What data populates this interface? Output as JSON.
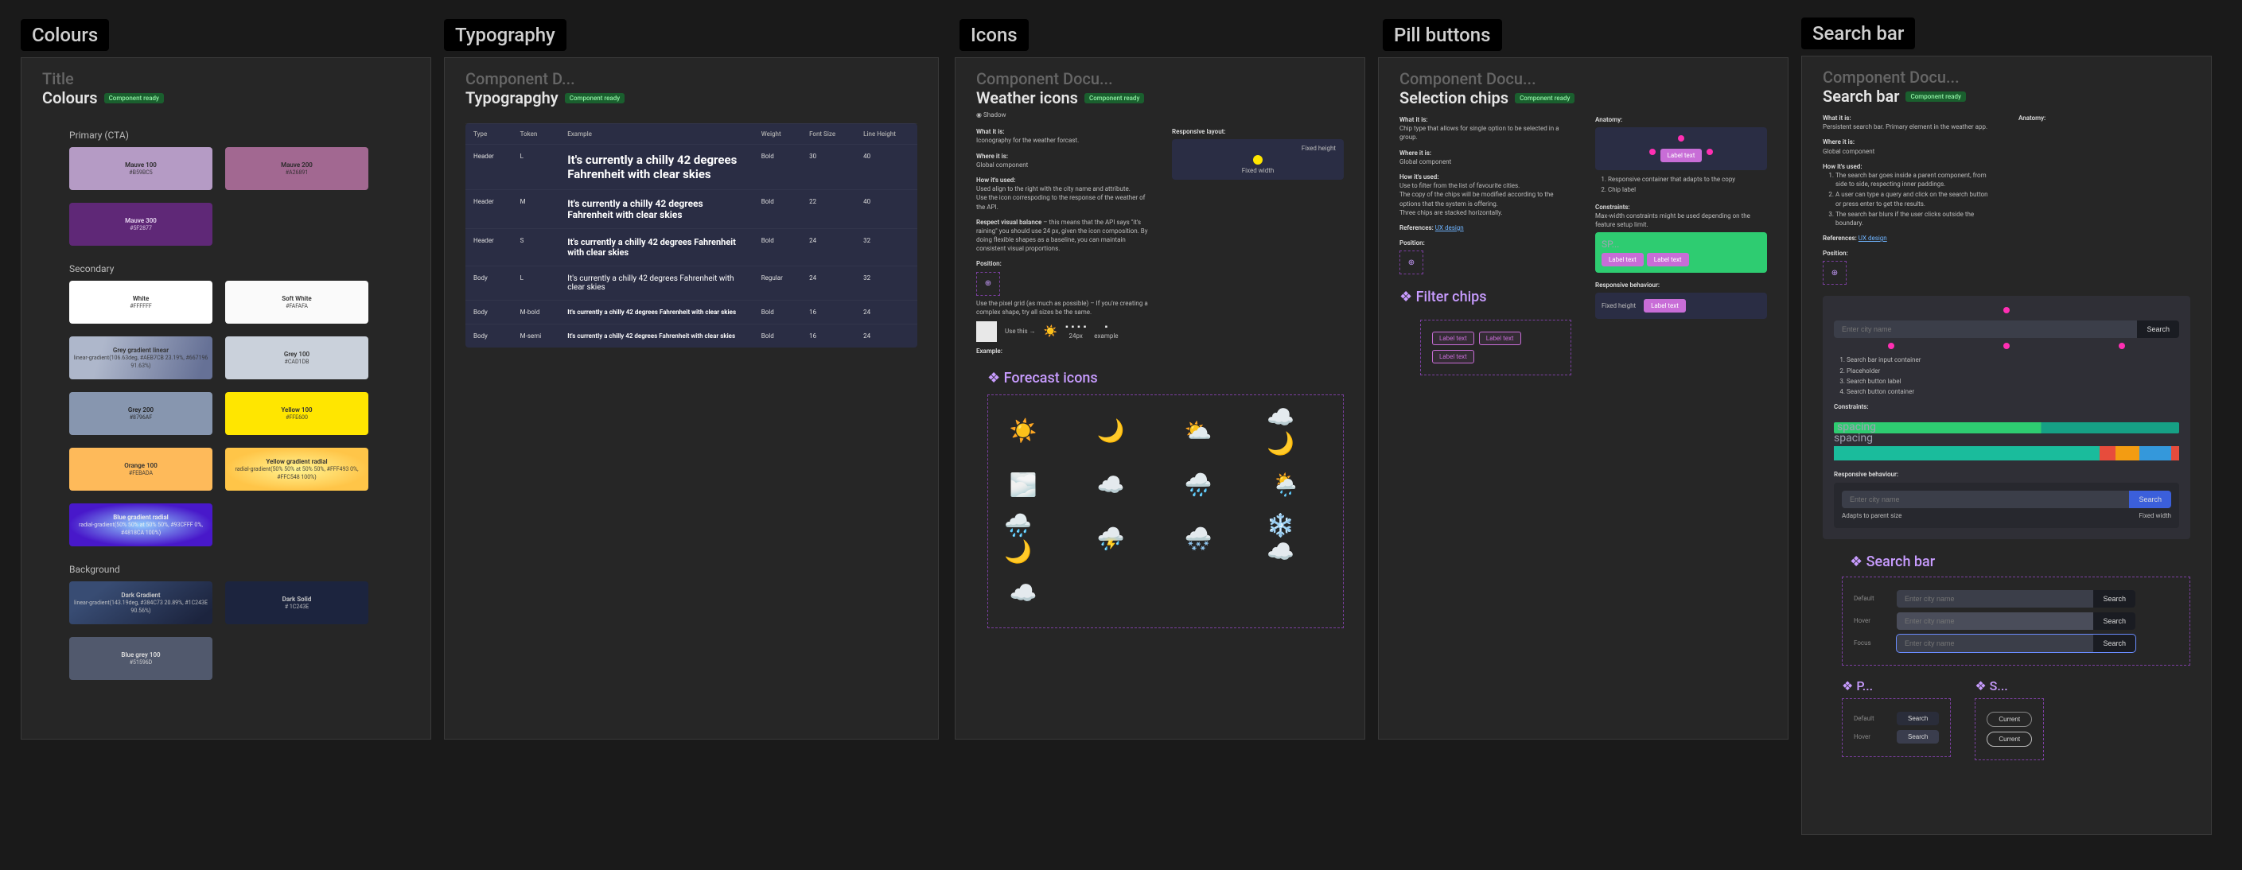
{
  "labels": {
    "colours": "Colours",
    "typography": "Typography",
    "icons": "Icons",
    "pill_buttons": "Pill buttons",
    "search_bar": "Search bar"
  },
  "common": {
    "component_docu": "Component Docu...",
    "component_d": "Component D...",
    "title": "Title",
    "component_ready": "Component ready",
    "what_it_is": "What it is:",
    "where_it_is": "Where it is:",
    "how_its_used": "How it's used:",
    "position": "Position:",
    "references": "References:",
    "anatomy": "Anatomy:",
    "constraints": "Constraints:",
    "responsive_behaviour": "Responsive behaviour:",
    "example": "Example:",
    "global_component": "Global component"
  },
  "colours": {
    "title": "Colours",
    "primary_h": "Primary (CTA)",
    "secondary_h": "Secondary",
    "background_h": "Background",
    "swatches": {
      "mauve100": {
        "name": "Mauve 100",
        "val": "#B59BC5",
        "bg": "#B59BC5",
        "fg": "#2a2a2a"
      },
      "mauve200": {
        "name": "Mauve 200",
        "val": "#A26891",
        "bg": "#A26891",
        "fg": "#2a2a2a"
      },
      "mauve300": {
        "name": "Mauve 300",
        "val": "#5F2877",
        "bg": "#5F2877",
        "fg": "#e8d7f2"
      },
      "white": {
        "name": "White",
        "val": "#FFFFFF",
        "bg": "#FFFFFF",
        "fg": "#333"
      },
      "softwhite": {
        "name": "Soft White",
        "val": "#FAFAFA",
        "bg": "#FAFAFA",
        "fg": "#333"
      },
      "greygrad": {
        "name": "Grey gradient linear",
        "val": "linear-gradient(106.63deg, #AEB7CB 23.19%, #667196 91.63%)",
        "fg": "#333"
      },
      "grey100": {
        "name": "Grey 100",
        "val": "#CAD1DB",
        "bg": "#CAD1DB",
        "fg": "#333"
      },
      "grey200": {
        "name": "Grey 200",
        "val": "#8796AF",
        "bg": "#8796AF",
        "fg": "#222"
      },
      "yellow100": {
        "name": "Yellow 100",
        "val": "#FFE600",
        "bg": "#FFE600",
        "fg": "#333"
      },
      "orange100": {
        "name": "Orange 100",
        "val": "#FEBADA",
        "bg": "#FEBA5A",
        "fg": "#333"
      },
      "yellowrad": {
        "name": "Yellow gradient radial",
        "val": "radial-gradient(50% 50% at 50% 50%, #FFF493 0%, #FFC548 100%)",
        "fg": "#333"
      },
      "bluerad": {
        "name": "Blue gradient radial",
        "val": "radial-gradient(50% 50% at 50% 50%, #93CFFF 0%, #4818CA 100%)",
        "fg": "#eee"
      },
      "darkgrad": {
        "name": "Dark Gradient",
        "val": "linear-gradient(143.19deg, #384C73 20.89%, #1C243E 90.56%)",
        "fg": "#ccc"
      },
      "darksolid": {
        "name": "Dark Solid",
        "val": "# 1C243E",
        "bg": "#1C243E",
        "fg": "#ccc"
      },
      "bluegrey": {
        "name": "Blue grey 100",
        "val": "#51596D",
        "bg": "#51596D",
        "fg": "#ddd"
      }
    }
  },
  "typography": {
    "title": "Typograpghy",
    "headers": {
      "type": "Type",
      "token": "Token",
      "example": "Example",
      "weight": "Weight",
      "fontsize": "Font Size",
      "lineheight": "Line Height"
    },
    "rows": [
      {
        "type": "Header",
        "token": "L",
        "ex": "It's currently a chilly 42 degrees Fahrenheit with clear skies",
        "ex_fs": "15px",
        "ex_fw": "700",
        "weight": "Bold",
        "fs": "30",
        "lh": "40"
      },
      {
        "type": "Header",
        "token": "M",
        "ex": "It's currently a chilly 42 degrees Fahrenheit with clear skies",
        "ex_fs": "12px",
        "ex_fw": "700",
        "weight": "Bold",
        "fs": "22",
        "lh": "40"
      },
      {
        "type": "Header",
        "token": "S",
        "ex": "It's currently a chilly 42 degrees Fahrenheit with clear skies",
        "ex_fs": "11px",
        "ex_fw": "700",
        "weight": "Bold",
        "fs": "24",
        "lh": "32"
      },
      {
        "type": "Body",
        "token": "L",
        "ex": "It's currently a chilly 42 degrees Fahrenheit with clear skies",
        "ex_fs": "10px",
        "ex_fw": "400",
        "weight": "Regular",
        "fs": "24",
        "lh": "32"
      },
      {
        "type": "Body",
        "token": "M-bold",
        "ex": "It's currently a chilly 42 degrees Fahrenheit with clear skies",
        "ex_fs": "8px",
        "ex_fw": "700",
        "weight": "Bold",
        "fs": "16",
        "lh": "24"
      },
      {
        "type": "Body",
        "token": "M-semi",
        "ex": "It's currently a chilly 42 degrees Fahrenheit with clear skies",
        "ex_fs": "8px",
        "ex_fw": "600",
        "weight": "Bold",
        "fs": "16",
        "lh": "24"
      }
    ]
  },
  "icons": {
    "title": "Weather icons",
    "shadow": "Shadow",
    "what_it_is_copy": "Iconography for the weather forcast.",
    "how_used_1": "Used align to the right with the city name and attribute.",
    "how_used_2": "Use the icon correspoding to the response of the weather of the API.",
    "respect_head": "Respect visual balance",
    "respect_copy": "– this means that the API says \"it's raining\" you should use 24 px, given the icon composition. By doing flexible shapes as a baseline, you can maintain consistent visual proportions.",
    "pixel_grid": "Use the pixel grid (as much as possible) – If you're creating a complex shape, try all sizes be the same.",
    "responsive_layout": "Responsive layout:",
    "fixed_height": "Fixed height",
    "fixed_width": "Fixed width",
    "use_this": "Use this →",
    "px24": "24px",
    "example": "example",
    "forecast_heading": "❖ Forecast icons"
  },
  "pill": {
    "title": "Selection chips",
    "what_copy": "Chip type that allows for single option to be selected in a group.",
    "how_used_1": "Use to filter from the list of favourite cities.",
    "how_used_2": "The copy of the chips will be modified according to the options that the system is offering.",
    "how_used_3": "Three chips are stacked horizontally.",
    "references_link": "UX design",
    "filter_heading": "❖ Filter chips",
    "chip_label": "Label text",
    "anatomy_items": [
      "Responsive container that adapts to the copy",
      "Chip label"
    ],
    "constraint_note": "Max-width constraints might be used depending on the feature setup limit.",
    "sp": "SP...",
    "fixed_height": "Fixed height"
  },
  "searchbar": {
    "title": "Search bar",
    "what_copy": "Persistent search bar. Primary element in the weather app.",
    "how_used": [
      "The search bar goes inside a parent component, from side to side, respecting inner paddings.",
      "A user can type a query and click on the search button or press enter to get the results.",
      "The search bar blurs if the user clicks outside the boundary."
    ],
    "references_link": "UX design",
    "input_placeholder": "Enter city name",
    "search_btn": "Search",
    "anatomy_items": [
      "Search bar input container",
      "Placeholder",
      "Search button label",
      "Search button container"
    ],
    "spacing": "spacing",
    "adapts": "Adapts to parent size",
    "fixed_width": "Fixed width",
    "search_heading": "❖ Search bar",
    "p_heading": "❖ P...",
    "s_heading": "❖ S...",
    "state_default": "Default",
    "state_hover": "Hover",
    "state_focus": "Focus",
    "current": "Current"
  }
}
